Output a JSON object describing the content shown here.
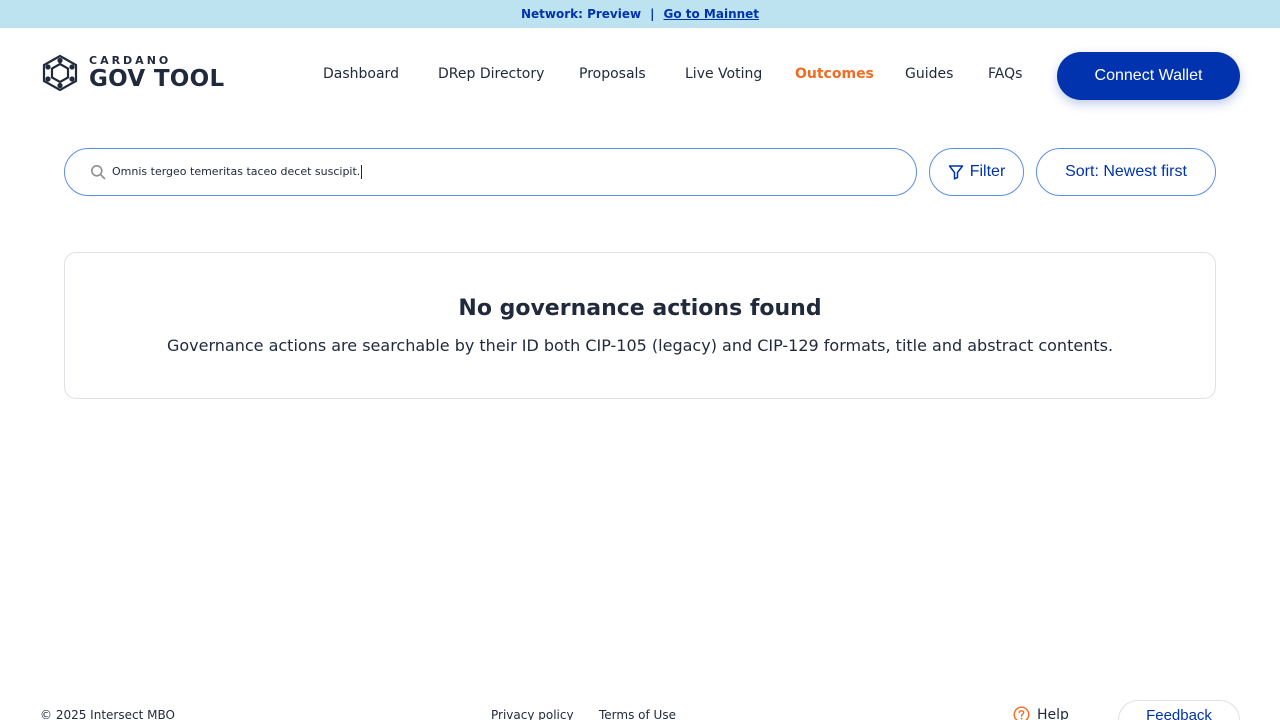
{
  "banner": {
    "network_label": "Network: Preview",
    "separator": "|",
    "mainnet_link": "Go to Mainnet"
  },
  "header": {
    "logo_sub": "CARDANO",
    "logo_main": "GOV TOOL",
    "nav": [
      {
        "label": "Dashboard",
        "active": false
      },
      {
        "label": "DRep Directory",
        "active": false
      },
      {
        "label": "Proposals",
        "active": false
      },
      {
        "label": "Live Voting",
        "active": false
      },
      {
        "label": "Outcomes",
        "active": true
      },
      {
        "label": "Guides",
        "active": false
      },
      {
        "label": "FAQs",
        "active": false
      }
    ],
    "connect_wallet_label": "Connect Wallet"
  },
  "search": {
    "value": "Omnis tergeo temeritas taceo decet suscipit.",
    "icon": "search-icon"
  },
  "toolbar": {
    "filter_label": "Filter",
    "sort_label": "Sort: Newest first"
  },
  "empty_state": {
    "title": "No governance actions found",
    "description": "Governance actions are searchable by their ID both CIP-105 (legacy) and CIP-129 formats, title and abstract contents."
  },
  "footer": {
    "copyright": "© 2025 Intersect MBO",
    "privacy_label": "Privacy policy",
    "terms_label": "Terms of Use",
    "help_label": "Help",
    "feedback_label": "Feedback"
  },
  "colors": {
    "banner_bg": "#bde3f0",
    "primary": "#0033ad",
    "active_nav": "#f26b21",
    "text": "#212a3d",
    "outline": "#5b8ee9"
  }
}
